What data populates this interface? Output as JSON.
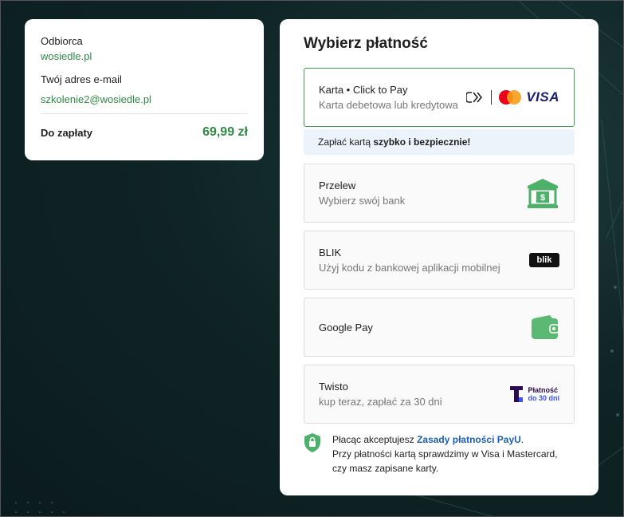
{
  "summary": {
    "recipient_label": "Odbiorca",
    "recipient_value": "wosiedle.pl",
    "email_label": "Twój adres e-mail",
    "email_value": "szkolenie2@wosiedle.pl",
    "total_label": "Do zapłaty",
    "total_amount": "69,99 zł"
  },
  "payment": {
    "title": "Wybierz płatność",
    "card": {
      "title": "Karta • Click to Pay",
      "subtitle": "Karta debetowa lub kredytowa",
      "visa_text": "VISA",
      "icon": "click-to-pay-icon"
    },
    "promo": {
      "prefix": "Zapłać kartą ",
      "bold": "szybko i bezpiecznie!"
    },
    "transfer": {
      "title": "Przelew",
      "subtitle": "Wybierz swój bank",
      "icon": "bank-icon"
    },
    "blik": {
      "title": "BLIK",
      "subtitle": "Użyj kodu z bankowej aplikacji mobilnej",
      "logo_text": "blik"
    },
    "googlepay": {
      "title": "Google Pay",
      "icon": "wallet-icon"
    },
    "twisto": {
      "title": "Twisto",
      "subtitle": "kup teraz, zapłać za 30 dni",
      "logo_line1": "Płatność",
      "logo_line2": "do 30 dni"
    },
    "footer": {
      "prefix": "Płacąc akceptujesz ",
      "link": "Zasady płatności PayU",
      "suffix": ".",
      "line2": "Przy płatności kartą sprawdzimy w Visa i Mastercard,",
      "line3": "czy masz zapisane karty."
    }
  },
  "colors": {
    "accent_green": "#2e8a45",
    "link_blue": "#1a5fb4",
    "background_dark": "#0f2426"
  }
}
